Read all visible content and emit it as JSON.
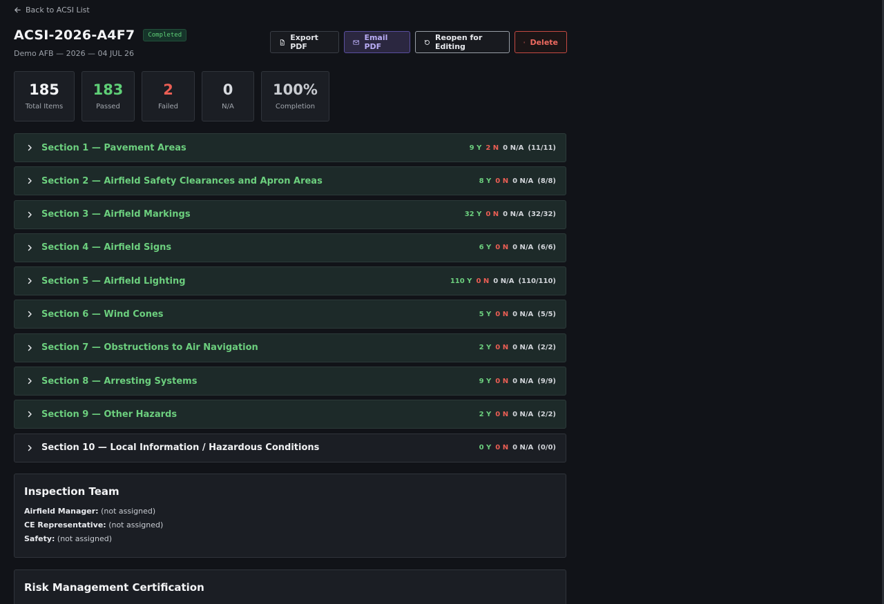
{
  "nav": {
    "back_label": "Back to ACSI List"
  },
  "header": {
    "title": "ACSI-2026-A4F7",
    "status": "Completed",
    "subtitle": "Demo AFB — 2026 — 04 JUL 26"
  },
  "actions": {
    "export_pdf": "Export PDF",
    "email_pdf": "Email PDF",
    "reopen": "Reopen for Editing",
    "delete": "Delete"
  },
  "stats": [
    {
      "value": "185",
      "label": "Total Items",
      "color": "#f3f4f6"
    },
    {
      "value": "183",
      "label": "Passed",
      "color": "#5fcf77"
    },
    {
      "value": "2",
      "label": "Failed",
      "color": "#ea5e54"
    },
    {
      "value": "0",
      "label": "N/A",
      "color": "#d8dbe0"
    },
    {
      "value": "100%",
      "label": "Completion",
      "color": "#c9ccd1"
    }
  ],
  "sections": [
    {
      "title": "Section 1 — Pavement Areas",
      "y": "9 Y",
      "n": "2 N",
      "na": "0 N/A",
      "total": "(11/11)"
    },
    {
      "title": "Section 2 — Airfield Safety Clearances and Apron Areas",
      "y": "8 Y",
      "n": "0 N",
      "na": "0 N/A",
      "total": "(8/8)"
    },
    {
      "title": "Section 3 — Airfield Markings",
      "y": "32 Y",
      "n": "0 N",
      "na": "0 N/A",
      "total": "(32/32)"
    },
    {
      "title": "Section 4 — Airfield Signs",
      "y": "6 Y",
      "n": "0 N",
      "na": "0 N/A",
      "total": "(6/6)"
    },
    {
      "title": "Section 5 — Airfield Lighting",
      "y": "110 Y",
      "n": "0 N",
      "na": "0 N/A",
      "total": "(110/110)"
    },
    {
      "title": "Section 6 — Wind Cones",
      "y": "5 Y",
      "n": "0 N",
      "na": "0 N/A",
      "total": "(5/5)"
    },
    {
      "title": "Section 7 — Obstructions to Air Navigation",
      "y": "2 Y",
      "n": "0 N",
      "na": "0 N/A",
      "total": "(2/2)"
    },
    {
      "title": "Section 8 — Arresting Systems",
      "y": "9 Y",
      "n": "0 N",
      "na": "0 N/A",
      "total": "(9/9)"
    },
    {
      "title": "Section 9 — Other Hazards",
      "y": "2 Y",
      "n": "0 N",
      "na": "0 N/A",
      "total": "(2/2)"
    },
    {
      "title": "Section 10 — Local Information / Hazardous Conditions",
      "y": "0 Y",
      "n": "0 N",
      "na": "0 N/A",
      "total": "(0/0)"
    }
  ],
  "team": {
    "title": "Inspection Team",
    "members": [
      {
        "role": "Airfield Manager:",
        "value": "(not assigned)"
      },
      {
        "role": "CE Representative:",
        "value": "(not assigned)"
      },
      {
        "role": "Safety:",
        "value": "(not assigned)"
      }
    ]
  },
  "risk": {
    "title": "Risk Management Certification"
  }
}
